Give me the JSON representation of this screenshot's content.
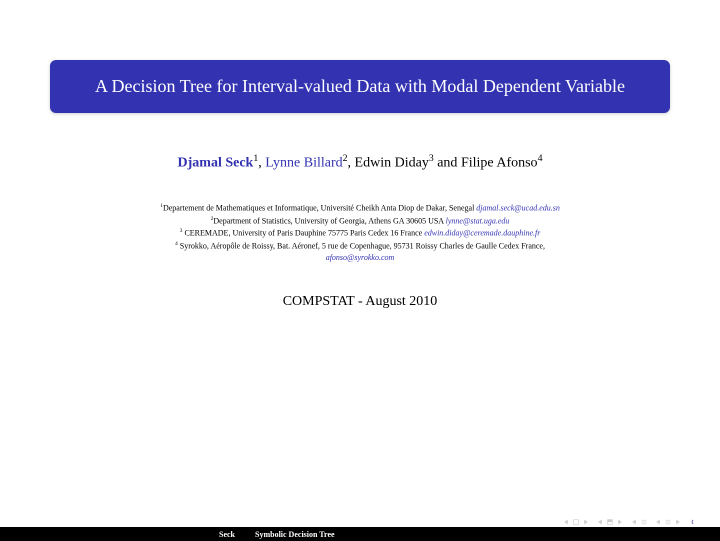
{
  "title": "A Decision Tree for Interval-valued Data with Modal Dependent Variable",
  "authors": {
    "a1": "Djamal Seck",
    "s1": "1",
    "sep1": ", ",
    "a2": "Lynne Billard",
    "s2": "2",
    "sep2": ", ",
    "a3": "Edwin Diday",
    "s3": "3",
    "sep3": " and ",
    "a4": "Filipe Afonso",
    "s4": "4"
  },
  "affils": {
    "l1a": "1",
    "l1b": "Departement de Mathematiques et Informatique, Université Cheikh Anta Diop de Dakar, Senegal ",
    "l1c": "djamal.seck@ucad.edu.sn",
    "l2a": "2",
    "l2b": "Department of Statistics, University of Georgia, Athens GA 30605 USA ",
    "l2c": "lynne@stat.uga.edu",
    "l3a": "3",
    "l3b": " CEREMADE, University of Paris Dauphine  75775 Paris Cedex 16 France ",
    "l3c": "edwin.diday@ceremade.dauphine.fr",
    "l4a": "4",
    "l4b": " Syrokko, Aéropôle de Roissy, Bat. Aéronef, 5 rue de Copenhague, 95731 Roissy Charles de Gaulle Cedex France,",
    "l4c": "afonso@syrokko.com"
  },
  "venue": "COMPSTAT - August 2010",
  "footer": {
    "author": "Seck",
    "title": "Symbolic Decision Tree"
  }
}
